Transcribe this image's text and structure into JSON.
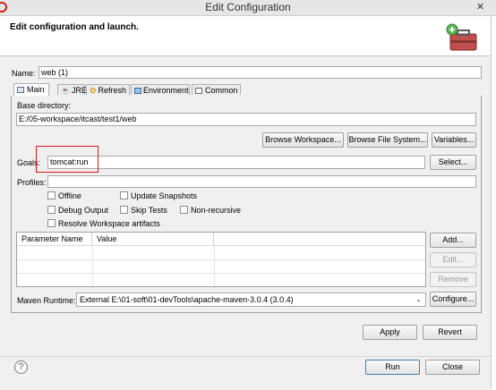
{
  "window": {
    "title": "Edit Configuration",
    "close": "✕"
  },
  "header": {
    "description": "Edit configuration and launch."
  },
  "name": {
    "label": "Name:",
    "value": "web (1)"
  },
  "tabs": [
    {
      "label": "Main",
      "icon": "main-tab-icon"
    },
    {
      "label": "JRE",
      "icon": "jre-icon"
    },
    {
      "label": "Refresh",
      "icon": "refresh-icon"
    },
    {
      "label": "Environment",
      "icon": "environment-icon"
    },
    {
      "label": "Common",
      "icon": "common-icon"
    }
  ],
  "main": {
    "base_directory_label": "Base directory:",
    "base_directory_value": "E:/05-workspace/itcast/test1/web",
    "browse_workspace": "Browse Workspace...",
    "browse_file_system": "Browse File System...",
    "variables": "Variables...",
    "goals_label": "Goals:",
    "goals_value": "tomcat:run",
    "select": "Select...",
    "profiles_label": "Profiles:",
    "profiles_value": "",
    "checkboxes": {
      "offline": "Offline",
      "update_snapshots": "Update Snapshots",
      "debug_output": "Debug Output",
      "skip_tests": "Skip Tests",
      "non_recursive": "Non-recursive",
      "resolve_workspace": "Resolve Workspace artifacts"
    },
    "table": {
      "col_name": "Parameter Name",
      "col_value": "Value"
    },
    "add": "Add...",
    "edit": "Edit...",
    "remove": "Remove",
    "maven_runtime_label": "Maven Runtime:",
    "maven_runtime_value": "External E:\\01-soft\\01-devTools\\apache-maven-3.0.4 (3.0.4)",
    "configure": "Configure..."
  },
  "buttons": {
    "apply": "Apply",
    "revert": "Revert",
    "run": "Run",
    "close": "Close",
    "help": "?"
  },
  "colors": {
    "highlight": "#e0151a",
    "toolbox": "#c0504d"
  }
}
